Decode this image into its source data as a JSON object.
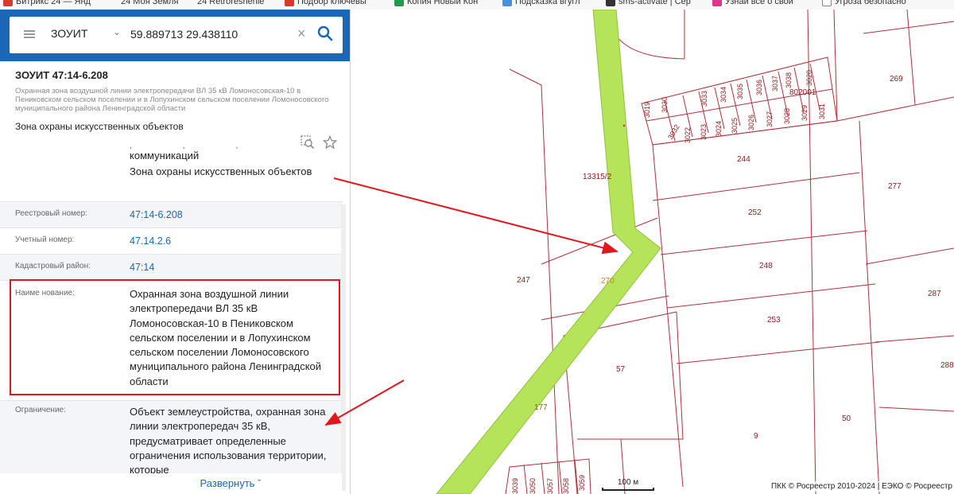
{
  "bookmarks": [
    {
      "label": "Битрикс 24 — Янд",
      "icon_color": "#d93a2b"
    },
    {
      "label": "24 Моя Земля",
      "icon_color": "#1a67b8"
    },
    {
      "label": "24 Retroreshenie",
      "icon_color": "#1a67b8"
    },
    {
      "label": "Подбор ключевы",
      "icon_color": "#d93a2b"
    },
    {
      "label": "Копия Новый Кон",
      "icon_color": "#1e9c4c"
    },
    {
      "label": "Подсказка вгугл",
      "icon_color": "#4a90d9"
    },
    {
      "label": "sms-activate | Сер",
      "icon_color": "#333333"
    },
    {
      "label": "Узнай все о свой",
      "icon_color": "#e0338a"
    },
    {
      "label": "Угроза безопасно",
      "icon_color": "#888888"
    }
  ],
  "search": {
    "layer": "ЗОУИТ",
    "query": "59.889713 29.438110"
  },
  "card": {
    "title": "ЗОУИТ 47:14-6.208",
    "subtitle": "Охранная зона воздушной линии электропередачи ВЛ 35 кВ Ломоносовская-10 в Пениковском сельском поселении и в Лопухинском сельском поселении Ломоносовского муниципального района Ленинградской области",
    "type": "Зона охраны искусственных объектов",
    "overflow_line1": "коммуникаций",
    "overflow_line2": "Зона охраны искусственных объектов"
  },
  "rows": [
    {
      "label": "Реестровый номер:",
      "value": "47:14-6.208"
    },
    {
      "label": "Учетный номер:",
      "value": "47.14.2.6"
    },
    {
      "label": "Кадастровый район:",
      "value": "47:14"
    },
    {
      "label": "Наиме нование:",
      "value": "Охранная зона воздушной линии электропередачи ВЛ 35 кВ Ломоносовская-10 в Пениковском сельском поселении и в Лопухинском сельском поселении Ломоносовского муниципального района Ленинградской области"
    },
    {
      "label": "Ограничение:",
      "value": "Объект землеустройства, охранная зона линии электропередач 35 кВ, предусматривает определенные ограничения использования территории, которые"
    }
  ],
  "expand_label": "Развернуть",
  "map": {
    "parcels": [
      "13315/2",
      "244",
      "252",
      "248",
      "253",
      "247",
      "270",
      "57",
      "177",
      "9",
      "50",
      "269",
      "277",
      "287",
      "288",
      "802001"
    ],
    "small_parcels_top": [
      "3019",
      "3030",
      "3032",
      "3033",
      "3034",
      "3035",
      "3036",
      "3037",
      "3038",
      "3020",
      "3031",
      "3022",
      "3023",
      "3024",
      "3025",
      "3026",
      "3027",
      "3028",
      "3029"
    ],
    "small_parcels_bottom": [
      "3039",
      "3050",
      "3057",
      "3058",
      "3059"
    ],
    "scale_label": "100 м",
    "copyright": "ПКК © Росреестр 2010-2024  |  ЕЭКО © Росреестр"
  },
  "colors": {
    "header_blue": "#1a67b8",
    "zone_green": "#b5e35a",
    "parcel_line": "#b2303a",
    "annotation_red": "#e3161d"
  }
}
